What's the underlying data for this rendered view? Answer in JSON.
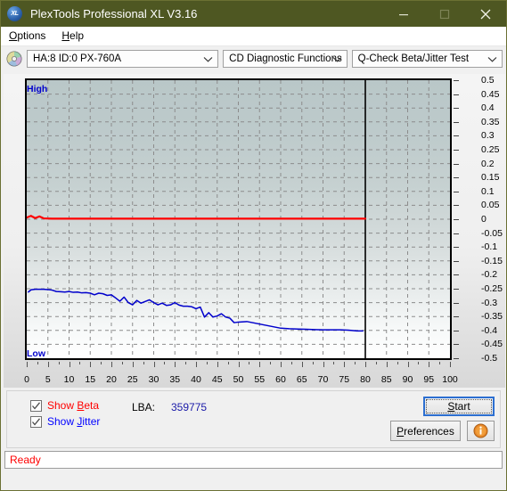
{
  "window": {
    "title": "PlexTools Professional XL V3.16",
    "logo_text": "XL",
    "minimize_label": "—",
    "maximize_label": "□",
    "close_label": "✕"
  },
  "menubar": {
    "items": [
      {
        "label": "Options",
        "accel": "O"
      },
      {
        "label": "Help",
        "accel": "H"
      }
    ]
  },
  "toolbar": {
    "drive_combo": "HA:8 ID:0  PX-760A",
    "function_combo": "CD Diagnostic Functions",
    "test_combo": "Q-Check Beta/Jitter Test"
  },
  "controls": {
    "show_beta_label": "Show Beta",
    "show_beta_accel": "B",
    "show_beta_checked": true,
    "show_jitter_label": "Show Jitter",
    "show_jitter_accel": "J",
    "show_jitter_checked": true,
    "lba_label": "LBA:",
    "lba_value": "359775",
    "start_label": "Start",
    "start_accel": "S",
    "preferences_label": "Preferences",
    "preferences_accel": "P",
    "info_label": "i"
  },
  "statusbar": {
    "text": "Ready"
  },
  "chart_data": {
    "type": "line",
    "title": "Q-Check Beta/Jitter Test",
    "xlabel": "",
    "ylabel": "",
    "xlim": [
      0,
      100
    ],
    "ylim": [
      -0.5,
      0.5
    ],
    "grid": true,
    "legend_position": "bottom-left",
    "y_axis_high_label": "High",
    "y_axis_low_label": "Low",
    "x_ticks": [
      0,
      5,
      10,
      15,
      20,
      25,
      30,
      35,
      40,
      45,
      50,
      55,
      60,
      65,
      70,
      75,
      80,
      85,
      90,
      95,
      100
    ],
    "y_ticks": [
      0.5,
      0.45,
      0.4,
      0.35,
      0.3,
      0.25,
      0.2,
      0.15,
      0.1,
      0.05,
      0,
      -0.05,
      -0.1,
      -0.15,
      -0.2,
      -0.25,
      -0.3,
      -0.35,
      -0.4,
      -0.45,
      -0.5
    ],
    "data_end_x": 80,
    "colors": {
      "beta": "#ff0000",
      "jitter": "#0000cc",
      "boundary": "#000000"
    },
    "series": [
      {
        "name": "Beta",
        "color": "#ff0000",
        "x": [
          0,
          1,
          2,
          3,
          4,
          6,
          8,
          10,
          15,
          20,
          25,
          30,
          35,
          40,
          45,
          50,
          55,
          60,
          65,
          70,
          75,
          80
        ],
        "y": [
          0.006,
          0.012,
          0.004,
          0.01,
          0.003,
          0.002,
          0.002,
          0.002,
          0.002,
          0.002,
          0.002,
          0.002,
          0.002,
          0.002,
          0.002,
          0.002,
          0.002,
          0.002,
          0.002,
          0.002,
          0.002,
          0.002
        ]
      },
      {
        "name": "Jitter",
        "color": "#0000cc",
        "x": [
          0.4,
          1,
          2,
          3,
          4,
          5,
          6,
          7,
          8,
          9,
          10,
          11,
          12,
          13,
          14,
          15,
          16,
          17,
          18,
          19,
          20,
          21,
          22,
          23,
          24,
          25,
          26,
          27,
          28,
          29,
          30,
          31,
          32,
          33,
          34,
          35,
          36,
          37,
          38,
          39,
          40,
          41,
          42,
          43,
          44,
          45,
          46,
          47,
          48,
          49,
          50,
          52,
          54,
          56,
          58,
          60,
          62,
          64,
          66,
          68,
          70,
          72,
          74,
          76,
          78,
          79.4
        ],
        "y": [
          -0.262,
          -0.254,
          -0.252,
          -0.252,
          -0.252,
          -0.253,
          -0.255,
          -0.26,
          -0.261,
          -0.262,
          -0.26,
          -0.263,
          -0.262,
          -0.265,
          -0.264,
          -0.266,
          -0.272,
          -0.266,
          -0.268,
          -0.274,
          -0.272,
          -0.283,
          -0.295,
          -0.28,
          -0.3,
          -0.308,
          -0.292,
          -0.302,
          -0.296,
          -0.29,
          -0.3,
          -0.308,
          -0.302,
          -0.31,
          -0.308,
          -0.3,
          -0.309,
          -0.313,
          -0.313,
          -0.315,
          -0.322,
          -0.316,
          -0.352,
          -0.336,
          -0.352,
          -0.348,
          -0.34,
          -0.352,
          -0.356,
          -0.372,
          -0.37,
          -0.368,
          -0.374,
          -0.38,
          -0.386,
          -0.392,
          -0.394,
          -0.395,
          -0.396,
          -0.397,
          -0.398,
          -0.398,
          -0.398,
          -0.399,
          -0.402,
          -0.402
        ]
      }
    ]
  }
}
